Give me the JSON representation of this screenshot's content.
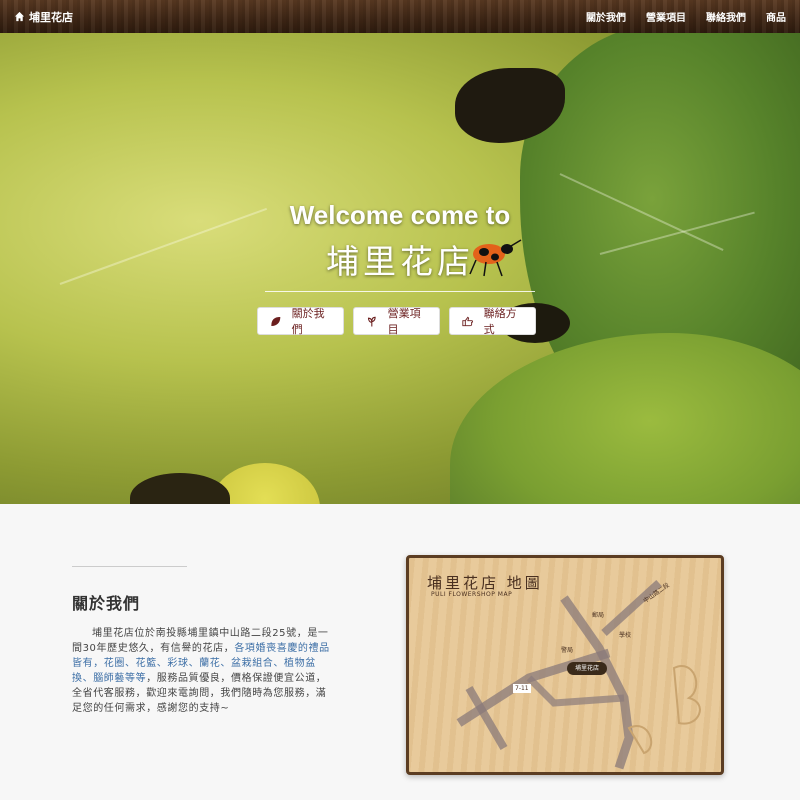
{
  "nav": {
    "brand": "埔里花店",
    "links": [
      "關於我們",
      "營業項目",
      "聯絡我們",
      "商品"
    ]
  },
  "hero": {
    "title": "Welcome come to",
    "subtitle": "埔里花店",
    "buttons": [
      {
        "label": "關於我們",
        "icon": "leaf-icon"
      },
      {
        "label": "營業項目",
        "icon": "sprout-icon"
      },
      {
        "label": "聯絡方式",
        "icon": "hand-point-icon"
      }
    ]
  },
  "about": {
    "title": "關於我們",
    "text_part1": "埔里花店位於南投縣埔里鎮中山路二段25號，是一間30年歷史悠久，有信譽的花店，",
    "text_highlight": "各項婚喪喜慶的禮品皆有，花圈、花籃、彩球、蘭花、盆栽組合、植物盆換、腦師藝等等",
    "text_part2": "，服務品質優良，價格保證便宜公道，全省代客服務，歡迎來電詢問，我們隨時為您服務，滿足您的任何需求，感謝您的支持~"
  },
  "map": {
    "title": "埔里花店 地圖",
    "subtitle": "PULI FLOWERSHOP MAP",
    "shop_label": "埔里花店",
    "labels": [
      "中山路二段",
      "郵局",
      "學校",
      "警局",
      "7-11"
    ]
  },
  "colors": {
    "nav_bg": "#3e2615",
    "button_text": "#6b1f1f",
    "link_highlight": "#3d6fa6"
  }
}
